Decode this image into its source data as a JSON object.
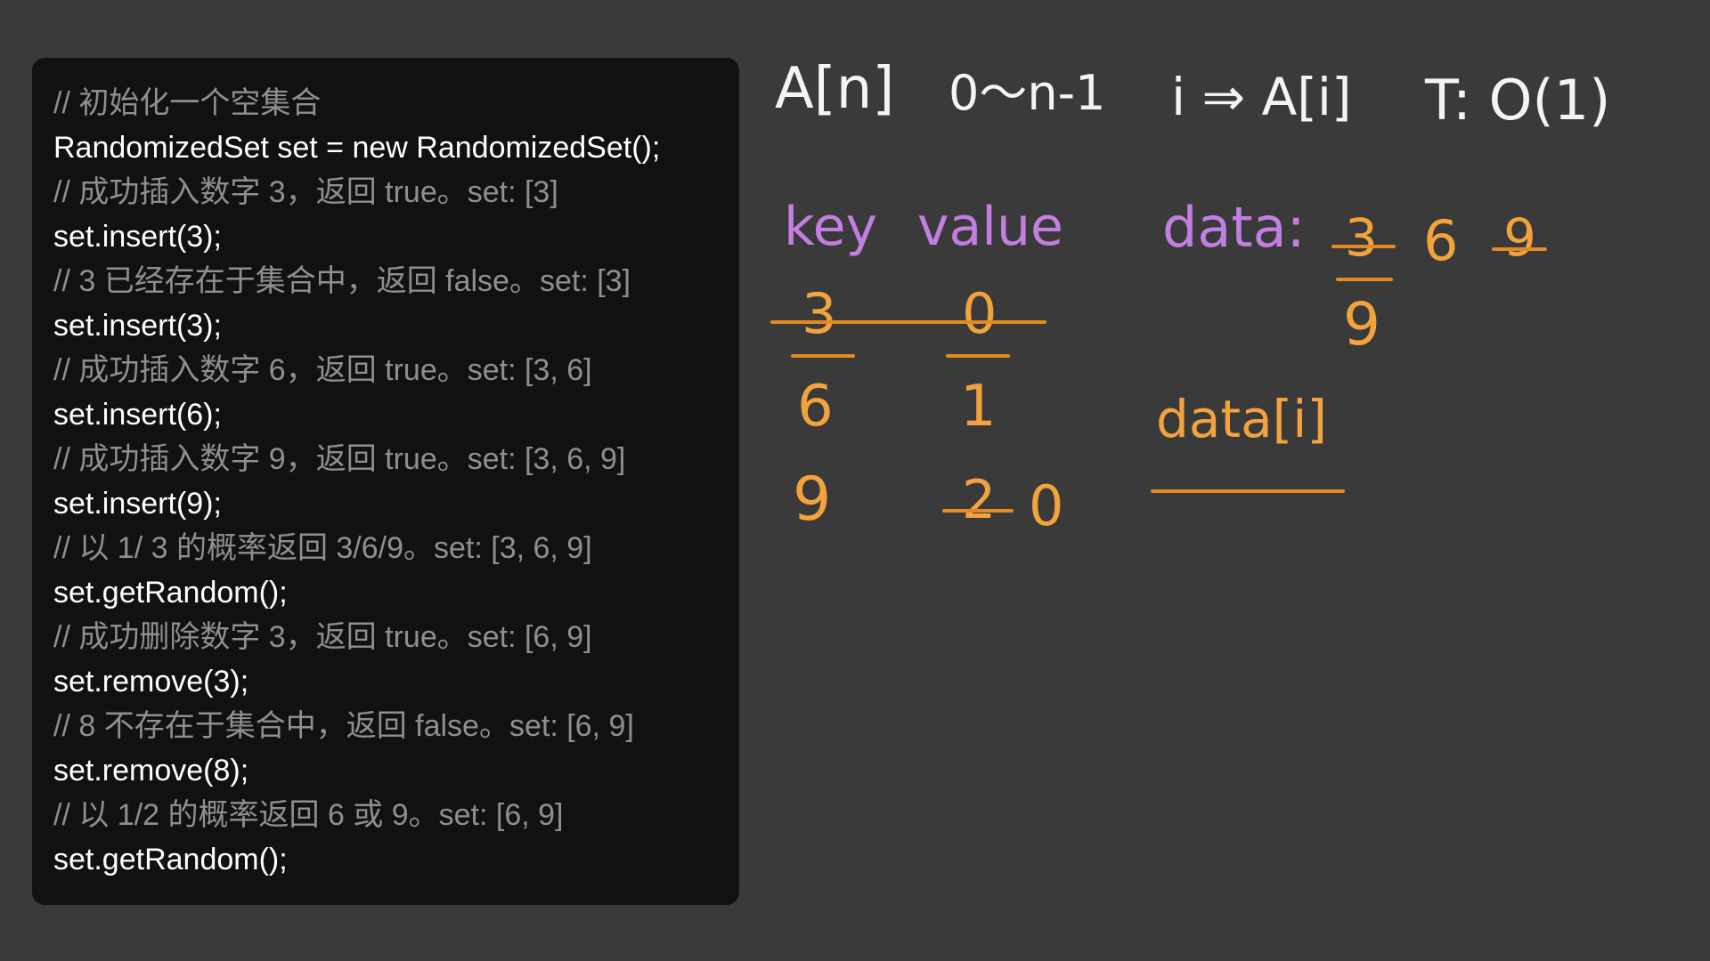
{
  "code_lines": [
    {
      "kind": "comment",
      "text": "// 初始化一个空集合"
    },
    {
      "kind": "code",
      "text": "RandomizedSet set = new RandomizedSet();"
    },
    {
      "kind": "comment",
      "text": "// 成功插入数字 3，返回 true。set: [3]"
    },
    {
      "kind": "code",
      "text": "set.insert(3);"
    },
    {
      "kind": "comment",
      "text": "// 3 已经存在于集合中，返回 false。set: [3]"
    },
    {
      "kind": "code",
      "text": "set.insert(3);"
    },
    {
      "kind": "comment",
      "text": "// 成功插入数字 6，返回 true。set: [3, 6]"
    },
    {
      "kind": "code",
      "text": "set.insert(6);"
    },
    {
      "kind": "comment",
      "text": "// 成功插入数字 9，返回 true。set: [3, 6, 9]"
    },
    {
      "kind": "code",
      "text": "set.insert(9);"
    },
    {
      "kind": "comment",
      "text": "// 以 1/ 3 的概率返回 3/6/9。set: [3, 6, 9]"
    },
    {
      "kind": "code",
      "text": "set.getRandom();"
    },
    {
      "kind": "comment",
      "text": "// 成功删除数字 3，返回 true。set: [6, 9]"
    },
    {
      "kind": "code",
      "text": "set.remove(3);"
    },
    {
      "kind": "comment",
      "text": "// 8 不存在于集合中，返回 false。set: [6, 9]"
    },
    {
      "kind": "code",
      "text": "set.remove(8);"
    },
    {
      "kind": "comment",
      "text": "// 以 1/2 的概率返回 6 或 9。set: [6, 9]"
    },
    {
      "kind": "code",
      "text": "set.getRandom();"
    }
  ],
  "notes": {
    "array_decl": "A[n]",
    "range": "0～n-1",
    "index_access": "i ⇒ A[i]",
    "complexity": "T: O(1)",
    "key_header": "key",
    "value_header": "value",
    "map_rows": [
      {
        "key": "3",
        "value": "0"
      },
      {
        "key": "6",
        "value": "1"
      },
      {
        "key": "9",
        "value": "2",
        "value_new": "0"
      }
    ],
    "data_label": "data:",
    "data_values": [
      "3",
      "6",
      "9"
    ],
    "data_replacement": "9",
    "data_index": "data[i]"
  },
  "colors": {
    "background": "#3a3a3a",
    "panel": "#111111",
    "comment": "#8f8f8f",
    "code": "#ffffff",
    "handwriting_white": "#f4f4f4",
    "handwriting_purple": "#c27ee0",
    "handwriting_orange": "#f2a33d"
  }
}
